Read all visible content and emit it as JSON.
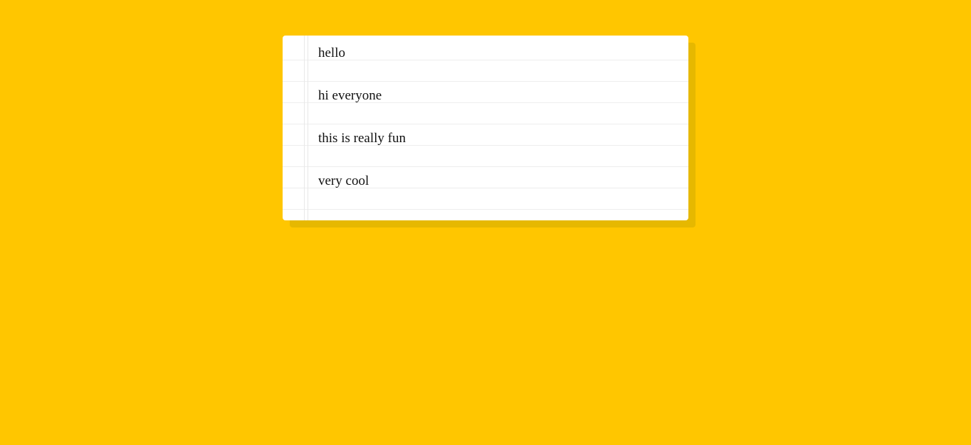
{
  "page": {
    "background_color": "#ffc600"
  },
  "note": {
    "lines": [
      "hello",
      "hi everyone",
      "this is really fun",
      "very cool"
    ]
  }
}
